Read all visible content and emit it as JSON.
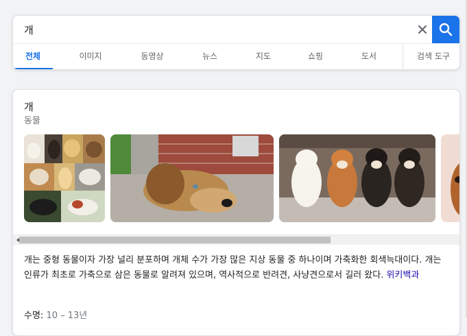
{
  "search": {
    "query": "개",
    "clear_icon": "close-icon",
    "search_icon": "search-icon"
  },
  "tabs": [
    {
      "label": "전체",
      "active": true
    },
    {
      "label": "이미지"
    },
    {
      "label": "동영상"
    },
    {
      "label": "뉴스"
    },
    {
      "label": "지도"
    },
    {
      "label": "쇼핑"
    },
    {
      "label": "도서"
    }
  ],
  "tools_label": "검색 도구",
  "knowledge_panel": {
    "title": "개",
    "subtitle": "동물",
    "images": [
      {
        "name": "dog-breeds-collage-image"
      },
      {
        "name": "dog-lying-on-ground-image"
      },
      {
        "name": "four-shiba-dogs-image"
      },
      {
        "name": "partial-dog-image"
      }
    ],
    "description": "개는 중형 동물이자 가장 널리 분포하며 개체 수가 가장 많은 지상 동물 중 하나이며 가축화한 회색늑대이다. 개는 인류가 최초로 가축으로 삼은 동물로 알려져 있으며, 역사적으로 반려견, 사냥견으로서 길러 왔다.",
    "source_link": "위키백과",
    "fact_label": "수명",
    "fact_value": "10 – 13년"
  },
  "colors": {
    "accent": "#1a73e8",
    "link": "#1a0dab"
  }
}
